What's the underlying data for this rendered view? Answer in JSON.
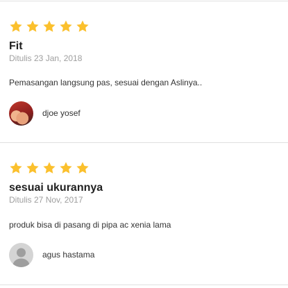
{
  "reviews": [
    {
      "rating": 5,
      "title": "Fit",
      "date": "Ditulis 23 Jan, 2018",
      "body": "Pemasangan langsung pas, sesuai dengan Aslinya..",
      "author": "djoe yosef",
      "avatar": "user-photo"
    },
    {
      "rating": 5,
      "title": "sesuai ukurannya",
      "date": "Ditulis 27 Nov, 2017",
      "body": "produk bisa di pasang di pipa ac xenia lama",
      "author": "agus hastama",
      "avatar": "default-user-icon"
    }
  ],
  "colors": {
    "star": "#fbc02d",
    "divider": "#e0e0e0",
    "date": "#9e9e9e"
  }
}
